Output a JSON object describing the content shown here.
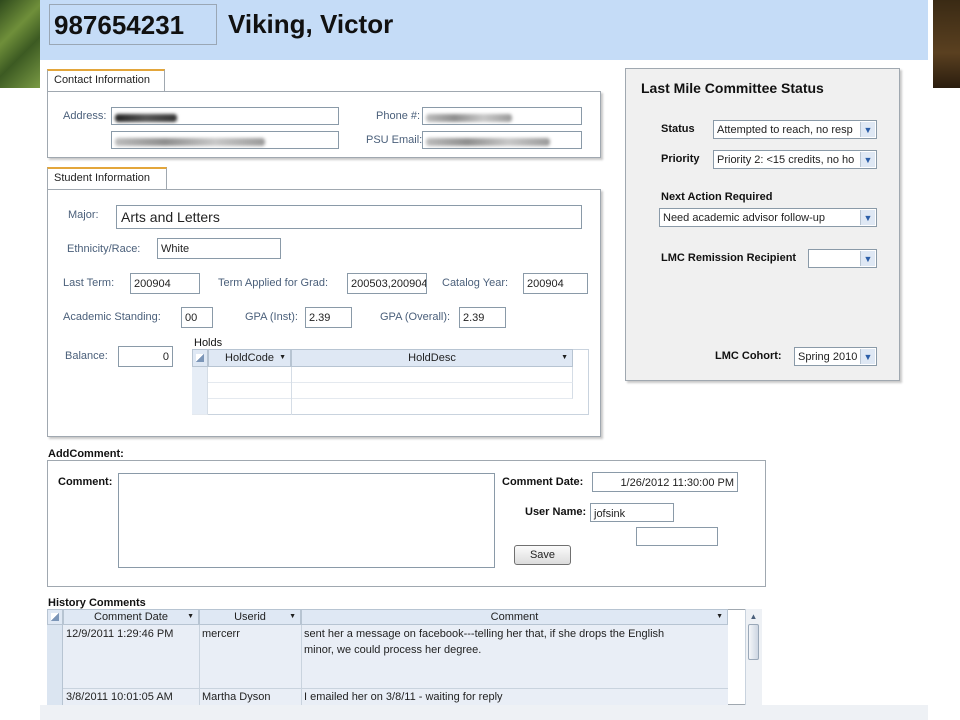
{
  "header": {
    "student_id": "987654231",
    "student_name": "Viking, Victor"
  },
  "contact": {
    "tab_label": "Contact Information",
    "address_label": "Address:",
    "phone_label": "Phone #:",
    "email_label": "PSU Email:"
  },
  "student": {
    "tab_label": "Student Information",
    "major_label": "Major:",
    "major": "Arts and Letters",
    "ethnicity_label": "Ethnicity/Race:",
    "ethnicity": "White",
    "last_term_label": "Last Term:",
    "last_term": "200904",
    "term_grad_label": "Term Applied for Grad:",
    "term_grad": "200503,200904",
    "catalog_label": "Catalog Year:",
    "catalog_year": "200904",
    "standing_label": "Academic Standing:",
    "standing": "00",
    "gpa_inst_label": "GPA (Inst):",
    "gpa_inst": "2.39",
    "gpa_overall_label": "GPA (Overall):",
    "gpa_overall": "2.39",
    "balance_label": "Balance:",
    "balance": "0",
    "holds_label": "Holds",
    "holds_columns": [
      "HoldCode",
      "HoldDesc"
    ]
  },
  "lmc": {
    "title": "Last Mile Committee Status",
    "status_label": "Status",
    "status_value": "Attempted to reach, no resp",
    "priority_label": "Priority",
    "priority_value": "Priority 2: <15 credits, no ho",
    "next_action_label": "Next Action Required",
    "next_action_value": "Need academic advisor follow-up",
    "remission_label": "LMC Remission Recipient",
    "remission_value": "",
    "cohort_label": "LMC Cohort:",
    "cohort_value": "Spring 2010"
  },
  "add_comment": {
    "section_label": "AddComment:",
    "comment_label": "Comment:",
    "date_label": "Comment Date:",
    "date_value": "1/26/2012 11:30:00 PM",
    "user_label": "User Name:",
    "user_value": "jofsink",
    "save_label": "Save"
  },
  "history": {
    "section_label": "History Comments",
    "columns": [
      "Comment Date",
      "Userid",
      "Comment"
    ],
    "rows": [
      {
        "date": "12/9/2011 1:29:46 PM",
        "user": "mercerr",
        "comment_line1": "sent her a message on facebook---telling her that, if she drops the English",
        "comment_line2": "minor,  we could process her degree."
      },
      {
        "date": "3/8/2011 10:01:05 AM",
        "user": "Martha Dyson",
        "comment_line1": "I emailed her on 3/8/11 - waiting for reply",
        "comment_line2": ""
      }
    ]
  }
}
